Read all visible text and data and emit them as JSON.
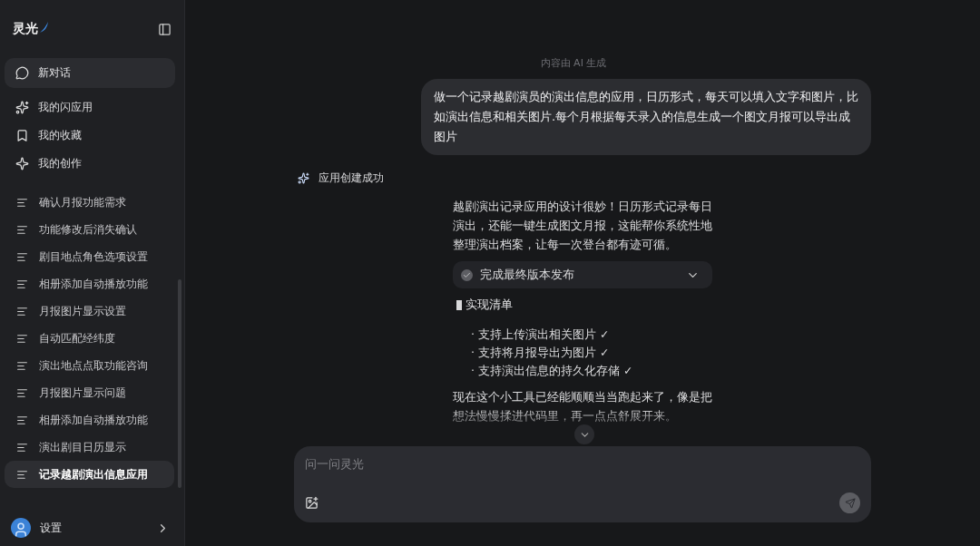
{
  "sidebar": {
    "logo": "灵光",
    "new_chat": "新对话",
    "nav": [
      {
        "label": "我的闪应用",
        "kind": "apps"
      },
      {
        "label": "我的收藏",
        "kind": "favorites"
      },
      {
        "label": "我的创作",
        "kind": "creations"
      }
    ],
    "history": [
      {
        "label": "确认月报功能需求",
        "selected": false
      },
      {
        "label": "功能修改后消失确认",
        "selected": false
      },
      {
        "label": "剧目地点角色选项设置",
        "selected": false
      },
      {
        "label": "相册添加自动播放功能",
        "selected": false
      },
      {
        "label": "月报图片显示设置",
        "selected": false
      },
      {
        "label": "自动匹配经纬度",
        "selected": false
      },
      {
        "label": "演出地点点取功能咨询",
        "selected": false
      },
      {
        "label": "月报图片显示问题",
        "selected": false
      },
      {
        "label": "相册添加自动播放功能",
        "selected": false
      },
      {
        "label": "演出剧目日历显示",
        "selected": false
      },
      {
        "label": "记录越剧演出信息应用",
        "selected": true
      }
    ],
    "footer": "设置"
  },
  "chat": {
    "notice": "内容由 AI 生成",
    "user_message": "做一个记录越剧演员的演出信息的应用，日历形式，每天可以填入文字和图片，比如演出信息和相关图片.每个月根据每天录入的信息生成一个图文月报可以导出成图片",
    "status": "应用创建成功",
    "reply": {
      "intro": "越剧演出记录应用的设计很妙！日历形式记录每日演出，还能一键生成图文月报，这能帮你系统性地整理演出档案，让每一次登台都有迹可循。",
      "step": "完成最终版本发布",
      "section_title": "实现清单",
      "items": [
        "· 支持上传演出相关图片 ✓",
        "· 支持将月报导出为图片 ✓",
        "· 支持演出信息的持久化存储 ✓"
      ],
      "outro": "现在这个小工具已经能顺顺当当跑起来了，像是把想法慢慢揉进代码里，再一点点舒展开来。"
    }
  },
  "composer": {
    "placeholder": "问一问灵光"
  }
}
